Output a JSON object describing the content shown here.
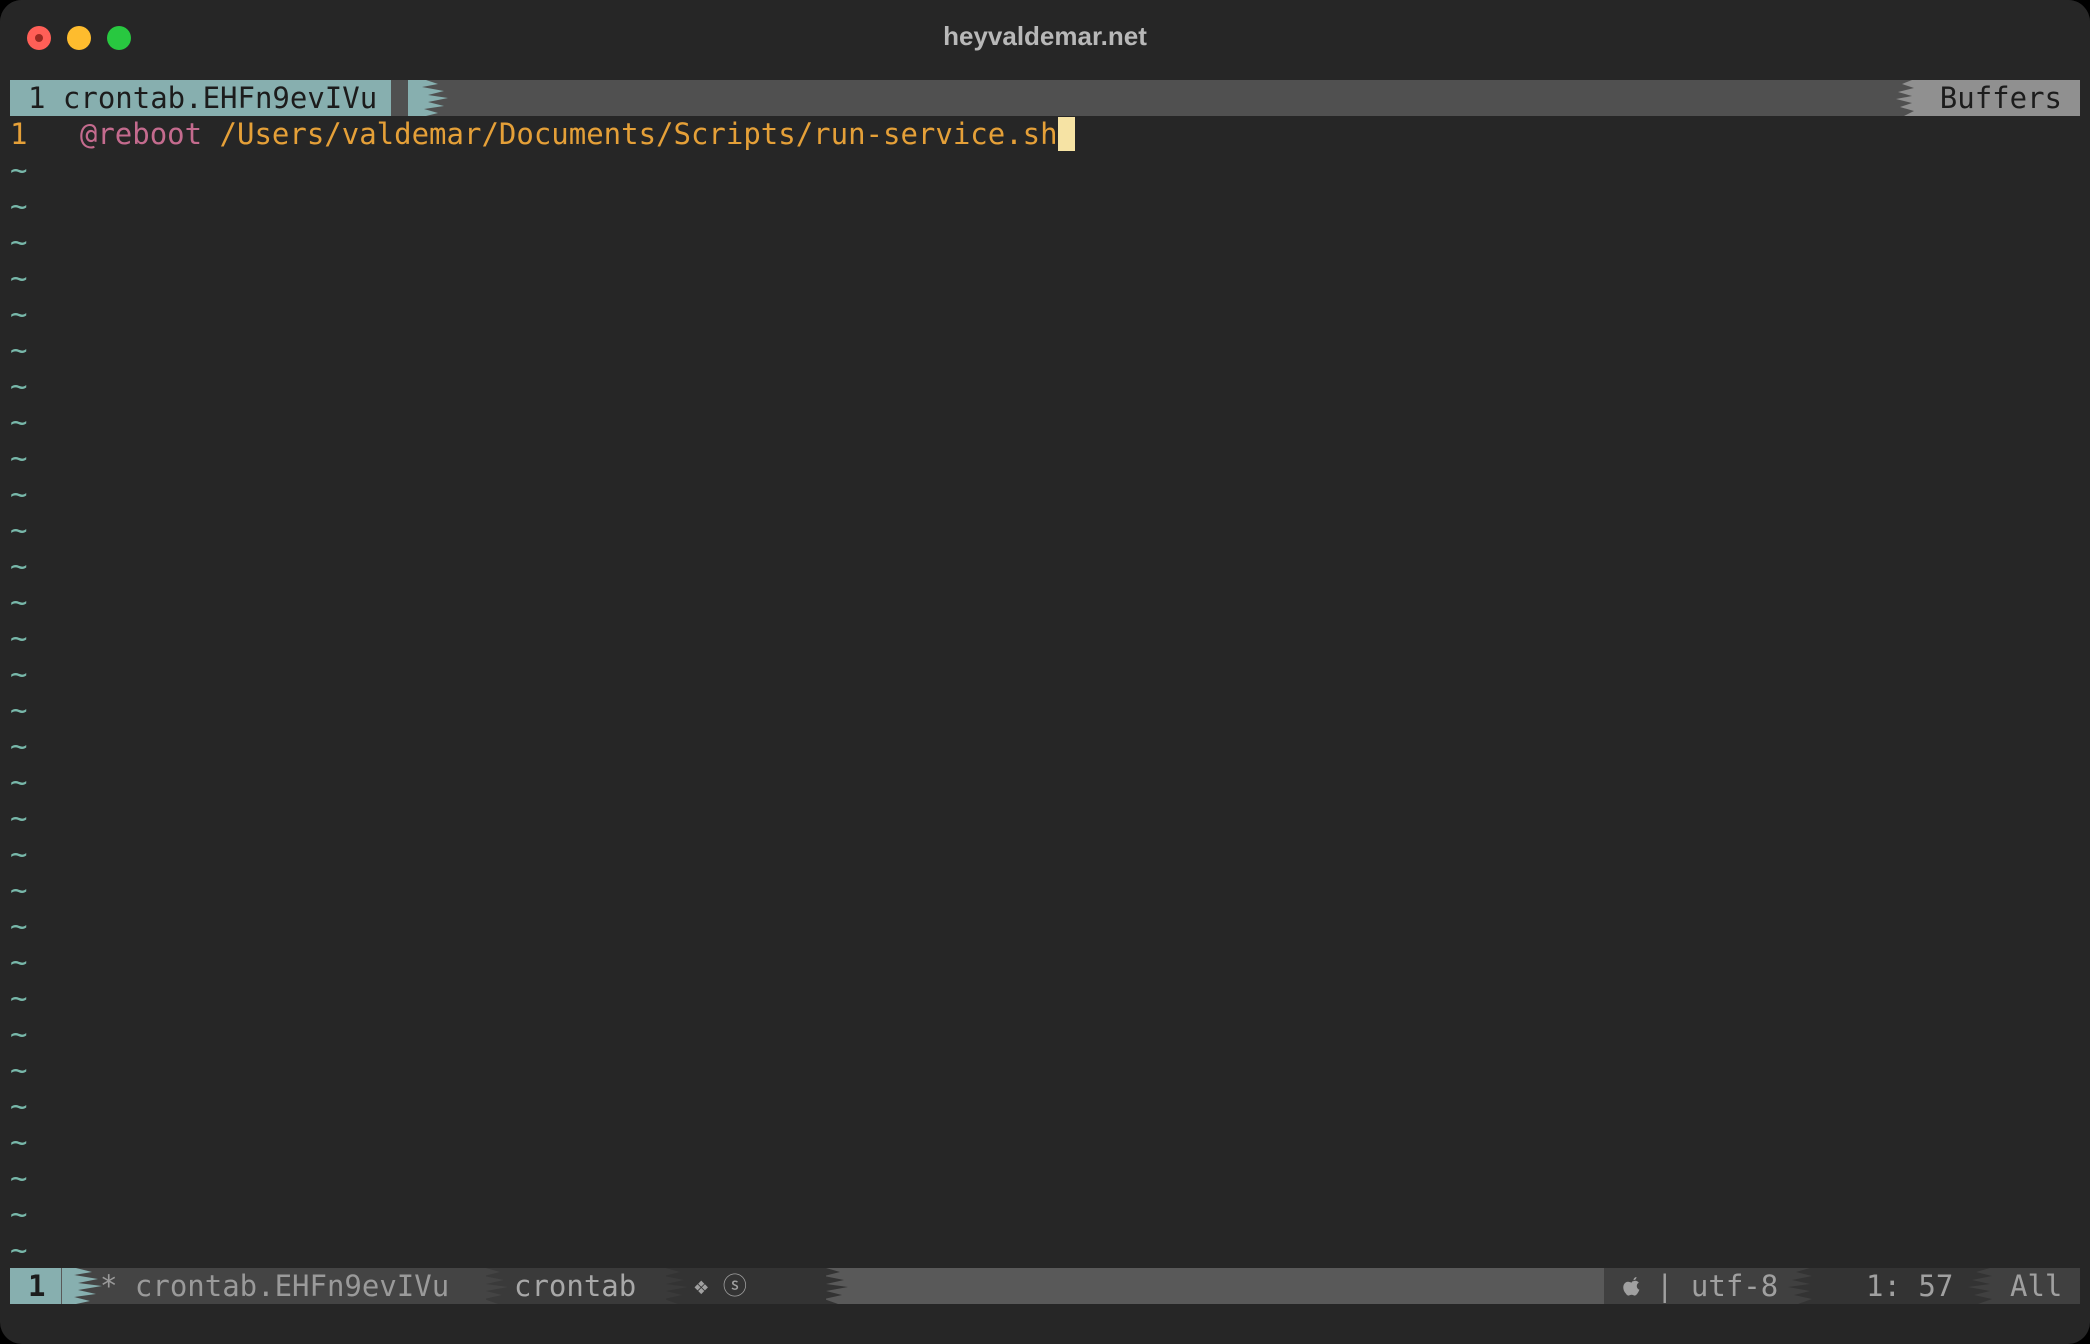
{
  "window": {
    "title": "heyvaldemar.net"
  },
  "tabline": {
    "active_tab": "1 crontab.EHFn9evIVu",
    "buffers_label": "Buffers"
  },
  "editor": {
    "lines": [
      {
        "number": "1",
        "keyword": "@reboot",
        "path": "/Users/valdemar/Documents/Scripts/run-service.sh"
      }
    ],
    "tilde": "~"
  },
  "statusline": {
    "window_number": "1",
    "file": "* crontab.EHFn9evIVu",
    "filetype": "crontab",
    "flags": "❖ ⓢ",
    "os_icon": "apple-icon",
    "encoding": "| utf-8",
    "position": "1: 57",
    "scroll": "All"
  },
  "colors": {
    "background": "#262626",
    "accent": "#87afaf",
    "line_number": "#e5a038",
    "keyword": "#c46b8e",
    "tilde": "#78b8aa",
    "cursor": "#f6e3a4"
  }
}
